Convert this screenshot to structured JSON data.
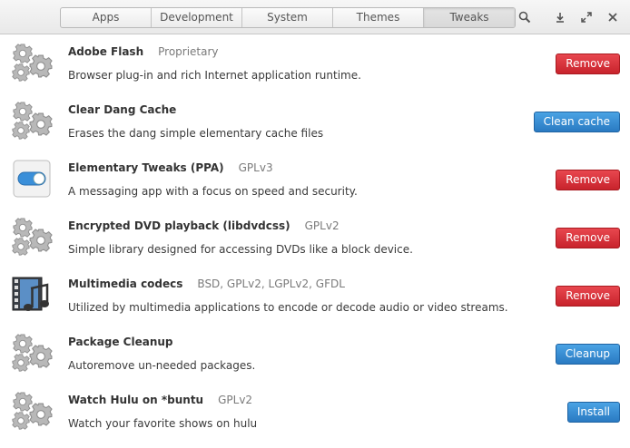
{
  "tabs": [
    {
      "label": "Apps"
    },
    {
      "label": "Development"
    },
    {
      "label": "System"
    },
    {
      "label": "Themes"
    },
    {
      "label": "Tweaks"
    }
  ],
  "active_tab": "Tweaks",
  "header_icons": [
    "search-icon",
    "download-icon",
    "expand-icon",
    "close-icon"
  ],
  "colors": {
    "remove": "#d12f37",
    "action": "#3289d6"
  },
  "items": [
    {
      "name": "Adobe Flash",
      "license": "Proprietary",
      "description": "Browser plug-in and rich Internet application runtime.",
      "action": "Remove",
      "icon": "gears-icon"
    },
    {
      "name": "Clear Dang Cache",
      "license": "",
      "description": "Erases the dang simple elementary cache files",
      "action": "Clean cache",
      "icon": "gears-icon"
    },
    {
      "name": "Elementary Tweaks (PPA)",
      "license": "GPLv3",
      "description": "A messaging app with a focus on speed and security.",
      "action": "Remove",
      "icon": "toggle-switch-icon"
    },
    {
      "name": "Encrypted DVD playback (libdvdcss)",
      "license": "GPLv2",
      "description": "Simple library designed for accessing DVDs like a block device.",
      "action": "Remove",
      "icon": "gears-icon"
    },
    {
      "name": "Multimedia codecs",
      "license": "BSD, GPLv2, LGPLv2, GFDL",
      "description": "Utilized by multimedia applications to encode or decode audio or video streams.",
      "action": "Remove",
      "icon": "multimedia-icon"
    },
    {
      "name": "Package Cleanup",
      "license": "",
      "description": "Autoremove un-needed packages.",
      "action": "Cleanup",
      "icon": "gears-icon"
    },
    {
      "name": "Watch Hulu on *buntu",
      "license": "GPLv2",
      "description": "Watch your favorite shows on hulu",
      "action": "Install",
      "icon": "gears-icon"
    }
  ]
}
